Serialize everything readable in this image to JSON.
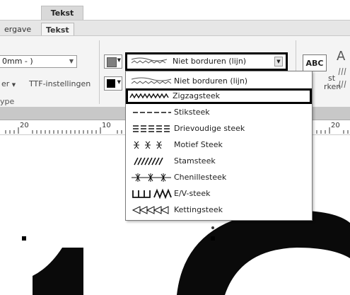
{
  "ribbon": {
    "contextual_tab": "Tekst",
    "tabs": [
      {
        "label": "ergave",
        "active": false
      },
      {
        "label": "Tekst",
        "active": true
      }
    ],
    "size_combo_value": "0mm - )",
    "letter_fragment": "er",
    "ttf_settings_label": "TTF-instellingen",
    "group_label": "ype",
    "stitch_combo_value": "Niet borduren (lijn)",
    "abc_button_label": "ABC",
    "right_fragment_1": "st",
    "right_fragment_2": "rken"
  },
  "stitch_menu": {
    "items": [
      {
        "icon": "straight-wavy-stitch-icon",
        "label": "Niet borduren (lijn)",
        "selected": false
      },
      {
        "icon": "zigzag-stitch-icon",
        "label": "Zigzagsteek",
        "selected": true
      },
      {
        "icon": "running-stitch-icon",
        "label": "Stiksteek",
        "selected": false
      },
      {
        "icon": "triple-stitch-icon",
        "label": "Drievoudige steek",
        "selected": false
      },
      {
        "icon": "motif-stitch-icon",
        "label": "Motief Steek",
        "selected": false
      },
      {
        "icon": "stem-stitch-icon",
        "label": "Stamsteek",
        "selected": false
      },
      {
        "icon": "chenille-stitch-icon",
        "label": "Chenillesteek",
        "selected": false
      },
      {
        "icon": "ev-stitch-icon",
        "label": "E/V-steek",
        "selected": false
      },
      {
        "icon": "chain-stitch-icon",
        "label": "Kettingsteek",
        "selected": false
      }
    ]
  },
  "ruler": {
    "labels": [
      "20",
      "10",
      "20"
    ]
  },
  "colors": {
    "line_color": "#7f7f7f",
    "region_color": "#000000",
    "artwork": "#0a0a0a"
  }
}
